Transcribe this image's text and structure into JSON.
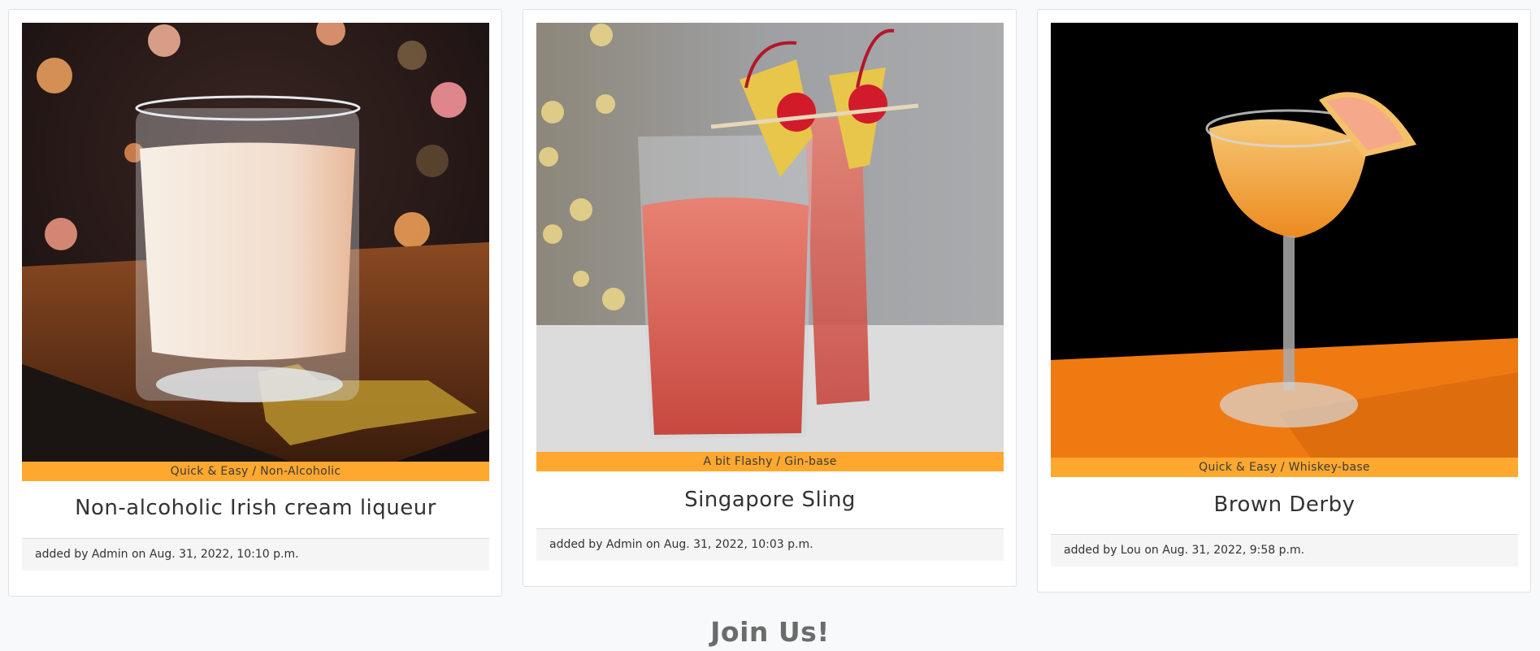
{
  "cards": [
    {
      "category": "Quick & Easy / Non-Alcoholic",
      "title": "Non-alcoholic Irish cream liqueur",
      "footer": "added by Admin on Aug. 31, 2022, 10:10 p.m."
    },
    {
      "category": "A bit Flashy / Gin-base",
      "title": "Singapore Sling",
      "footer": "added by Admin on Aug. 31, 2022, 10:03 p.m."
    },
    {
      "category": "Quick & Easy / Whiskey-base",
      "title": "Brown Derby",
      "footer": "added by Lou on Aug. 31, 2022, 9:58 p.m."
    }
  ],
  "join": {
    "heading": "Join Us!"
  },
  "colors": {
    "category_bar": "#fea82f",
    "page_background": "#f8f9fa",
    "card_background": "#ffffff"
  }
}
